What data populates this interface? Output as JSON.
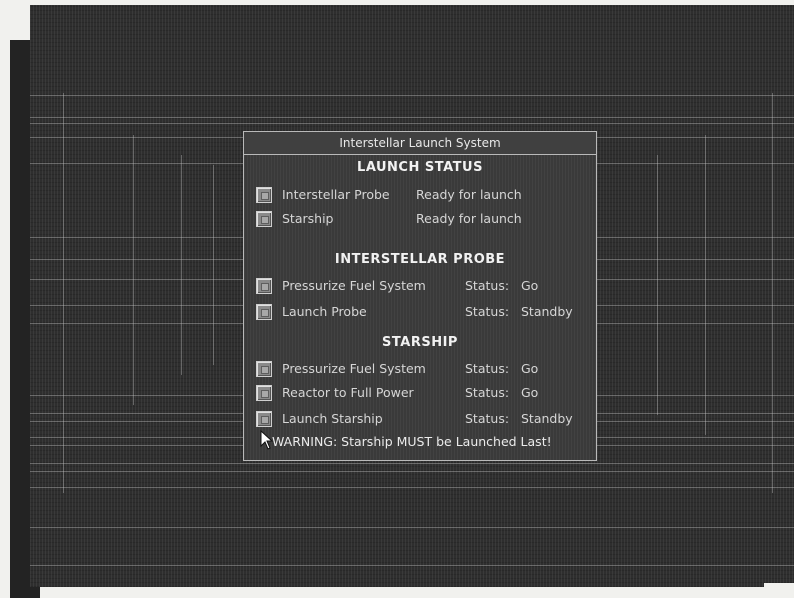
{
  "dialog": {
    "title": "Interstellar Launch System"
  },
  "launch_status": {
    "heading": "LAUNCH STATUS",
    "items": [
      {
        "label": "Interstellar Probe",
        "status": "Ready for launch"
      },
      {
        "label": "Starship",
        "status": "Ready for launch"
      }
    ]
  },
  "probe": {
    "heading": "INTERSTELLAR PROBE",
    "items": [
      {
        "label": "Pressurize Fuel System",
        "status_label": "Status:",
        "status_value": "Go"
      },
      {
        "label": "Launch Probe",
        "status_label": "Status:",
        "status_value": "Standby"
      }
    ]
  },
  "starship": {
    "heading": "STARSHIP",
    "items": [
      {
        "label": "Pressurize Fuel System",
        "status_label": "Status:",
        "status_value": "Go"
      },
      {
        "label": "Reactor to Full Power",
        "status_label": "Status:",
        "status_value": "Go"
      },
      {
        "label": "Launch Starship",
        "status_label": "Status:",
        "status_value": "Standby"
      }
    ]
  },
  "warning": "WARNING: Starship MUST be Launched Last!"
}
